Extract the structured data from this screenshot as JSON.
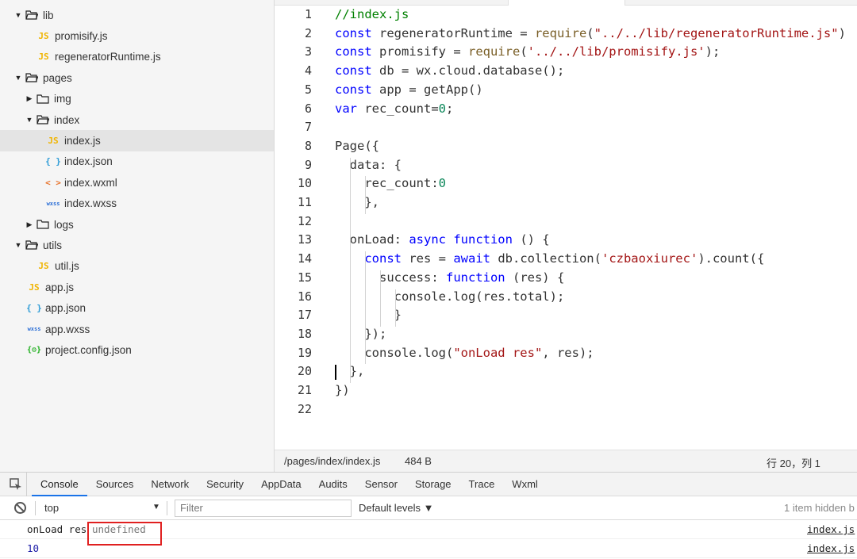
{
  "file_tree": [
    {
      "depth": 0,
      "type": "folder",
      "expanded": true,
      "label": "lib"
    },
    {
      "depth": 1,
      "type": "js",
      "label": "promisify.js"
    },
    {
      "depth": 1,
      "type": "js",
      "label": "regeneratorRuntime.js"
    },
    {
      "depth": 0,
      "type": "folder",
      "expanded": true,
      "label": "pages"
    },
    {
      "depth": 1,
      "type": "folder",
      "expanded": false,
      "label": "img"
    },
    {
      "depth": 1,
      "type": "folder",
      "expanded": true,
      "label": "index"
    },
    {
      "depth": 2,
      "type": "js",
      "label": "index.js",
      "selected": true
    },
    {
      "depth": 2,
      "type": "json",
      "label": "index.json"
    },
    {
      "depth": 2,
      "type": "wxml",
      "label": "index.wxml"
    },
    {
      "depth": 2,
      "type": "wxss",
      "label": "index.wxss"
    },
    {
      "depth": 1,
      "type": "folder",
      "expanded": false,
      "label": "logs"
    },
    {
      "depth": 0,
      "type": "folder",
      "expanded": true,
      "label": "utils"
    },
    {
      "depth": 1,
      "type": "js",
      "label": "util.js"
    },
    {
      "depth": 0,
      "type": "js",
      "label": "app.js"
    },
    {
      "depth": 0,
      "type": "json",
      "label": "app.json"
    },
    {
      "depth": 0,
      "type": "wxss",
      "label": "app.wxss"
    },
    {
      "depth": 0,
      "type": "config",
      "label": "project.config.json"
    }
  ],
  "icon_glyphs": {
    "js": "JS",
    "json": "{ }",
    "wxml": "< >",
    "wxss": "wxss",
    "config": "{⚙}"
  },
  "code_lines": [
    [
      [
        "cm",
        "//index.js"
      ]
    ],
    [
      [
        "kw",
        "const"
      ],
      [
        "",
        "regeneratorRuntime = "
      ],
      [
        "fn",
        "require"
      ],
      [
        "",
        "("
      ],
      [
        "str",
        "\"../../lib/regeneratorRuntime.js\""
      ],
      [
        "",
        ")"
      ]
    ],
    [
      [
        "kw",
        "const"
      ],
      [
        "",
        "promisify = "
      ],
      [
        "fn",
        "require"
      ],
      [
        "",
        "("
      ],
      [
        "str",
        "'../../lib/promisify.js'"
      ],
      [
        "",
        ");"
      ]
    ],
    [
      [
        "kw",
        "const"
      ],
      [
        "",
        "db = wx.cloud.database();"
      ]
    ],
    [
      [
        "kw",
        "const"
      ],
      [
        "",
        "app = getApp()"
      ]
    ],
    [
      [
        "kw",
        "var"
      ],
      [
        "",
        "rec_count="
      ],
      [
        "num",
        "0"
      ],
      [
        "",
        ";"
      ]
    ],
    [],
    [
      [
        "",
        "Page({"
      ]
    ],
    [
      [
        "",
        "  data: {"
      ]
    ],
    [
      [
        "",
        "    rec_count:"
      ],
      [
        "num",
        "0"
      ]
    ],
    [
      [
        "",
        "    },"
      ]
    ],
    [],
    [
      [
        "",
        "  onLoad: "
      ],
      [
        "kw",
        "async function"
      ],
      [
        "",
        "() {"
      ]
    ],
    [
      [
        "",
        "    "
      ],
      [
        "kw",
        "const"
      ],
      [
        "",
        "res = "
      ],
      [
        "kw",
        "await"
      ],
      [
        "",
        "db.collection("
      ],
      [
        "str",
        "'czbaoxiurec'"
      ],
      [
        "",
        ").count({"
      ]
    ],
    [
      [
        "",
        "      success: "
      ],
      [
        "kw",
        "function"
      ],
      [
        "",
        "(res) {"
      ]
    ],
    [
      [
        "",
        "        console.log(res.total);"
      ]
    ],
    [
      [
        "",
        "        }"
      ]
    ],
    [
      [
        "",
        "    });"
      ]
    ],
    [
      [
        "",
        "    console.log("
      ],
      [
        "str",
        "\"onLoad res\""
      ],
      [
        "",
        ", res);"
      ]
    ],
    [
      [
        "",
        "  },"
      ]
    ],
    [
      [
        "",
        "})"
      ]
    ],
    []
  ],
  "status": {
    "path": "/pages/index/index.js",
    "size": "484 B",
    "position": "行 20，列 1"
  },
  "devtools": {
    "tabs": [
      "Console",
      "Sources",
      "Network",
      "Security",
      "AppData",
      "Audits",
      "Sensor",
      "Storage",
      "Trace",
      "Wxml"
    ],
    "active_tab": "Console",
    "context": "top",
    "filter_placeholder": "Filter",
    "levels": "Default levels ▼",
    "hidden_note": "1 item hidden b",
    "logs": [
      {
        "text": "onLoad res",
        "value": "undefined",
        "source": "index.js"
      },
      {
        "text": "",
        "value": "10",
        "source": "index.js"
      }
    ]
  }
}
